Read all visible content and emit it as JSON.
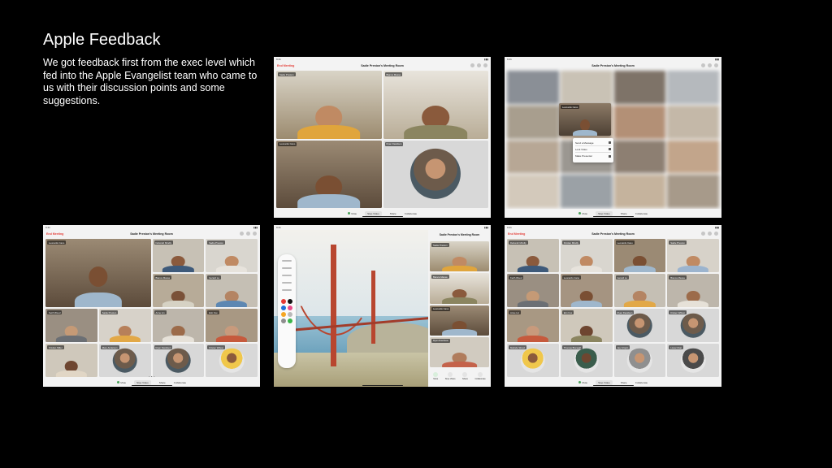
{
  "slide": {
    "title": "Apple Feedback",
    "description": "We got feedback first from the exec level which fed into the Apple Evangelist team who came to us with their discussion points and some suggestions."
  },
  "meeting": {
    "room_title": "Sadie Preston's Meeting Room",
    "end_label": "End Meeting",
    "status_time": "9:41",
    "status_date": "Mon Jun 10",
    "controls": [
      "Mute",
      "Stop Video",
      "Share",
      "Collaborate"
    ]
  },
  "screen1": {
    "participants": [
      "Sadie Preston",
      "Bianca Massa",
      "Leonardo Cano",
      "Ryan Davidson"
    ]
  },
  "screen2": {
    "focused": "Leonardo Cano",
    "menu": [
      "Send a Message",
      "Lock Video",
      "Make Presenter"
    ]
  },
  "screen3": {
    "participants": [
      "Leonardo Cano",
      "Deborah Mindly",
      "Sadie Preston",
      "Bianca Massa",
      "Gerard Lo",
      "Keith Wood",
      "Sadie Preston",
      "Anne Lin",
      "Erin Fox",
      "Kristian Miller",
      "Mary Anderson",
      "Ryan Davidson",
      "Kristen Wilson"
    ]
  },
  "screen4": {
    "participants": [
      "Sadie Preston",
      "Bianca Massa",
      "Leonardo Cano",
      "Ryan Davidson"
    ],
    "controls": [
      "Mute",
      "Stop Video",
      "Share",
      "Collaborate"
    ]
  },
  "screen5": {
    "participants": [
      "Deborah Mindly",
      "Kristian Mindly",
      "Leonardo Cano",
      "Sadie Preston",
      "Keith Wood",
      "Leonardo Cano",
      "Gerard Lo",
      "Bianca Massa",
      "Anne Lin",
      "Erin Fox",
      "Ryan Davidson",
      "Kristen Wilson",
      "Melinda Wood",
      "Thomas Branagh",
      "Jay Crispin",
      "Lissa Chan"
    ]
  }
}
